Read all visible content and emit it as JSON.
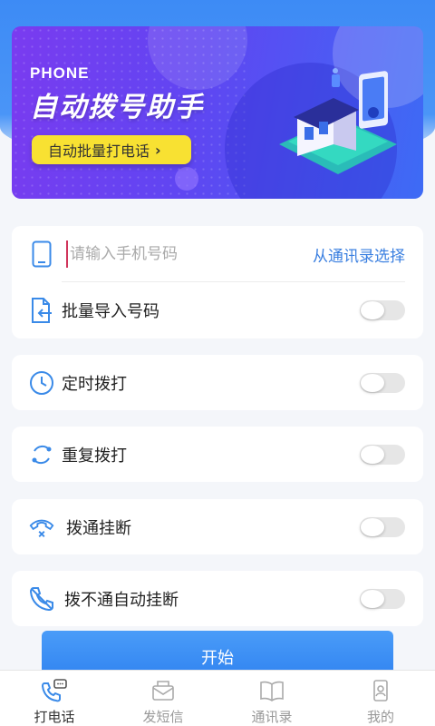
{
  "banner": {
    "phone_label": "PHONE",
    "title": "自动拨号助手",
    "batch_button": "自动批量打电话"
  },
  "input_card": {
    "phone_placeholder": "请输入手机号码",
    "contact_link": "从通讯录选择",
    "batch_import_label": "批量导入号码",
    "batch_import_on": false
  },
  "options": [
    {
      "label": "定时拨打",
      "icon": "clock-icon",
      "on": false
    },
    {
      "label": "重复拨打",
      "icon": "repeat-icon",
      "on": false
    },
    {
      "label": "拨通挂断",
      "icon": "hangup-icon",
      "on": false
    },
    {
      "label": "拨不通自动挂断",
      "icon": "phone-off-icon",
      "on": false
    }
  ],
  "start_button": "开始",
  "tabs": [
    {
      "label": "打电话",
      "icon": "phone-chat-icon",
      "active": true
    },
    {
      "label": "发短信",
      "icon": "envelope-icon",
      "active": false
    },
    {
      "label": "通讯录",
      "icon": "book-icon",
      "active": false
    },
    {
      "label": "我的",
      "icon": "user-phone-icon",
      "active": false
    }
  ],
  "colors": {
    "accent": "#3a7fe0",
    "banner_button": "#f8e132"
  }
}
